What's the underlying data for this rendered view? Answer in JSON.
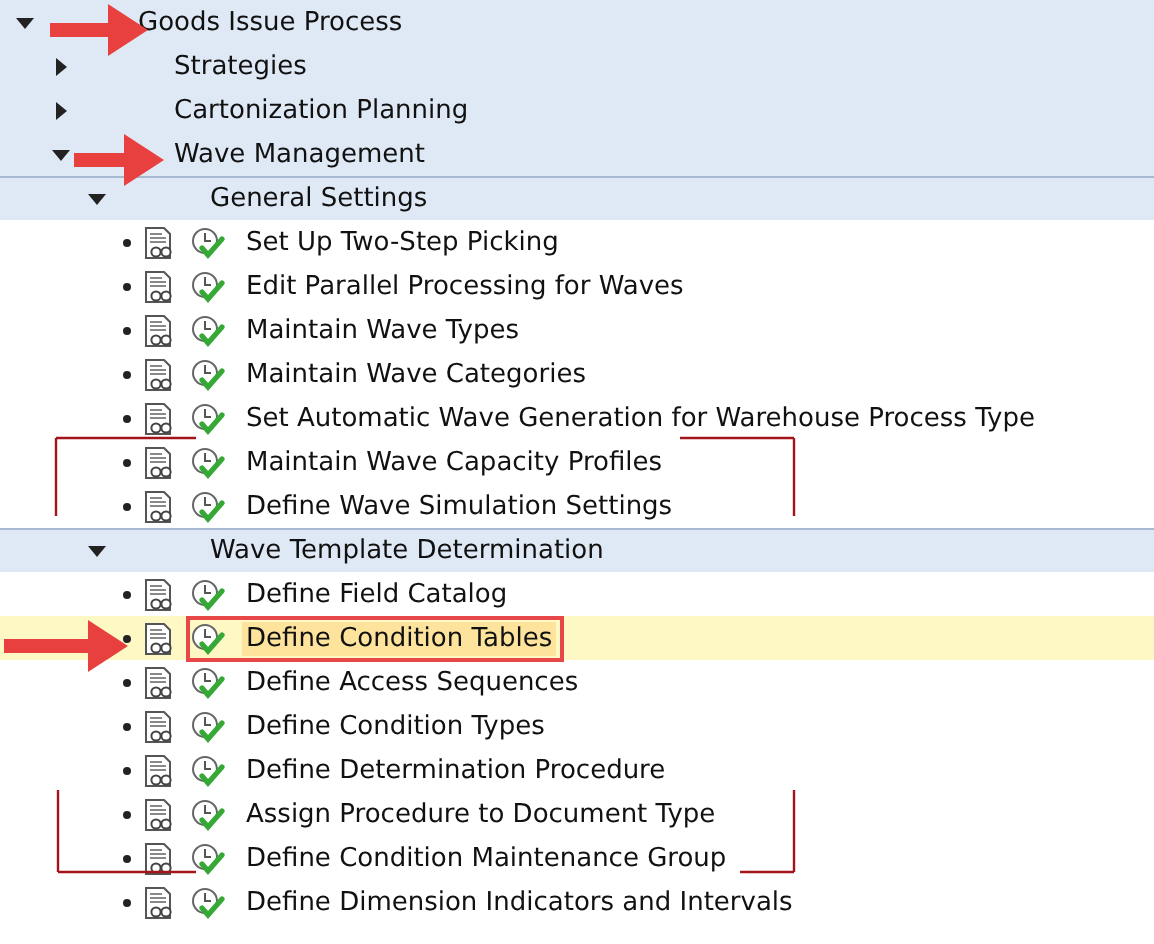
{
  "tree": [
    {
      "kind": "folder",
      "label": "Goods Issue Process",
      "expanded": true,
      "children": [
        {
          "kind": "folder",
          "label": "Strategies",
          "expanded": false
        },
        {
          "kind": "folder",
          "label": "Cartonization Planning",
          "expanded": false
        },
        {
          "kind": "folder",
          "label": "Wave Management",
          "expanded": true,
          "children": [
            {
              "kind": "folder",
              "label": "General Settings",
              "expanded": true,
              "children": [
                {
                  "kind": "activity",
                  "label": "Set Up Two-Step Picking",
                  "selected": false
                },
                {
                  "kind": "activity",
                  "label": "Edit Parallel Processing for Waves",
                  "selected": false
                },
                {
                  "kind": "activity",
                  "label": "Maintain Wave Types",
                  "selected": false
                },
                {
                  "kind": "activity",
                  "label": "Maintain Wave Categories",
                  "selected": false
                },
                {
                  "kind": "activity",
                  "label": "Set Automatic Wave Generation for Warehouse Process Type",
                  "selected": false
                },
                {
                  "kind": "activity",
                  "label": "Maintain Wave Capacity Profiles",
                  "selected": false
                },
                {
                  "kind": "activity",
                  "label": "Define Wave Simulation Settings",
                  "selected": false
                }
              ]
            },
            {
              "kind": "folder",
              "label": "Wave Template Determination",
              "expanded": true,
              "children": [
                {
                  "kind": "activity",
                  "label": "Define Field Catalog",
                  "selected": false
                },
                {
                  "kind": "activity",
                  "label": "Define Condition Tables",
                  "selected": true
                },
                {
                  "kind": "activity",
                  "label": "Define Access Sequences",
                  "selected": false
                },
                {
                  "kind": "activity",
                  "label": "Define Condition Types",
                  "selected": false
                },
                {
                  "kind": "activity",
                  "label": "Define Determination Procedure",
                  "selected": false
                },
                {
                  "kind": "activity",
                  "label": "Assign Procedure to Document Type",
                  "selected": false
                },
                {
                  "kind": "activity",
                  "label": "Define Condition Maintenance Group",
                  "selected": false
                },
                {
                  "kind": "activity",
                  "label": "Define Dimension Indicators and Intervals",
                  "selected": false
                }
              ]
            }
          ]
        }
      ]
    }
  ]
}
